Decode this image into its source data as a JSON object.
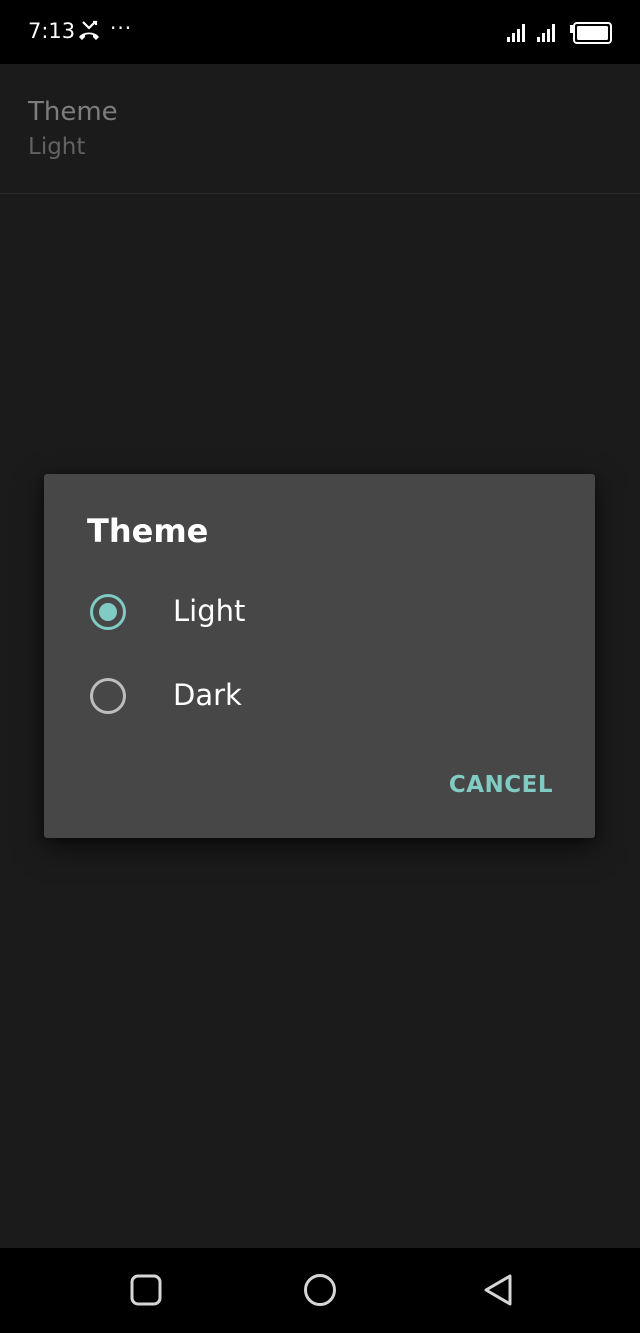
{
  "status_bar": {
    "time": "7:13",
    "more": "···",
    "icons": [
      "missed-call-icon",
      "more-icon",
      "signal-icon",
      "signal-icon",
      "battery-icon"
    ]
  },
  "preference": {
    "title": "Theme",
    "summary": "Light"
  },
  "dialog": {
    "title": "Theme",
    "options": [
      {
        "label": "Light",
        "selected": true
      },
      {
        "label": "Dark",
        "selected": false
      }
    ],
    "cancel_label": "CANCEL"
  },
  "nav_bar": {
    "icons": [
      "recent-apps-icon",
      "home-icon",
      "back-icon"
    ]
  },
  "colors": {
    "background": "#1b1b1b",
    "dialog": "#474747",
    "accent": "#80cbc4"
  }
}
